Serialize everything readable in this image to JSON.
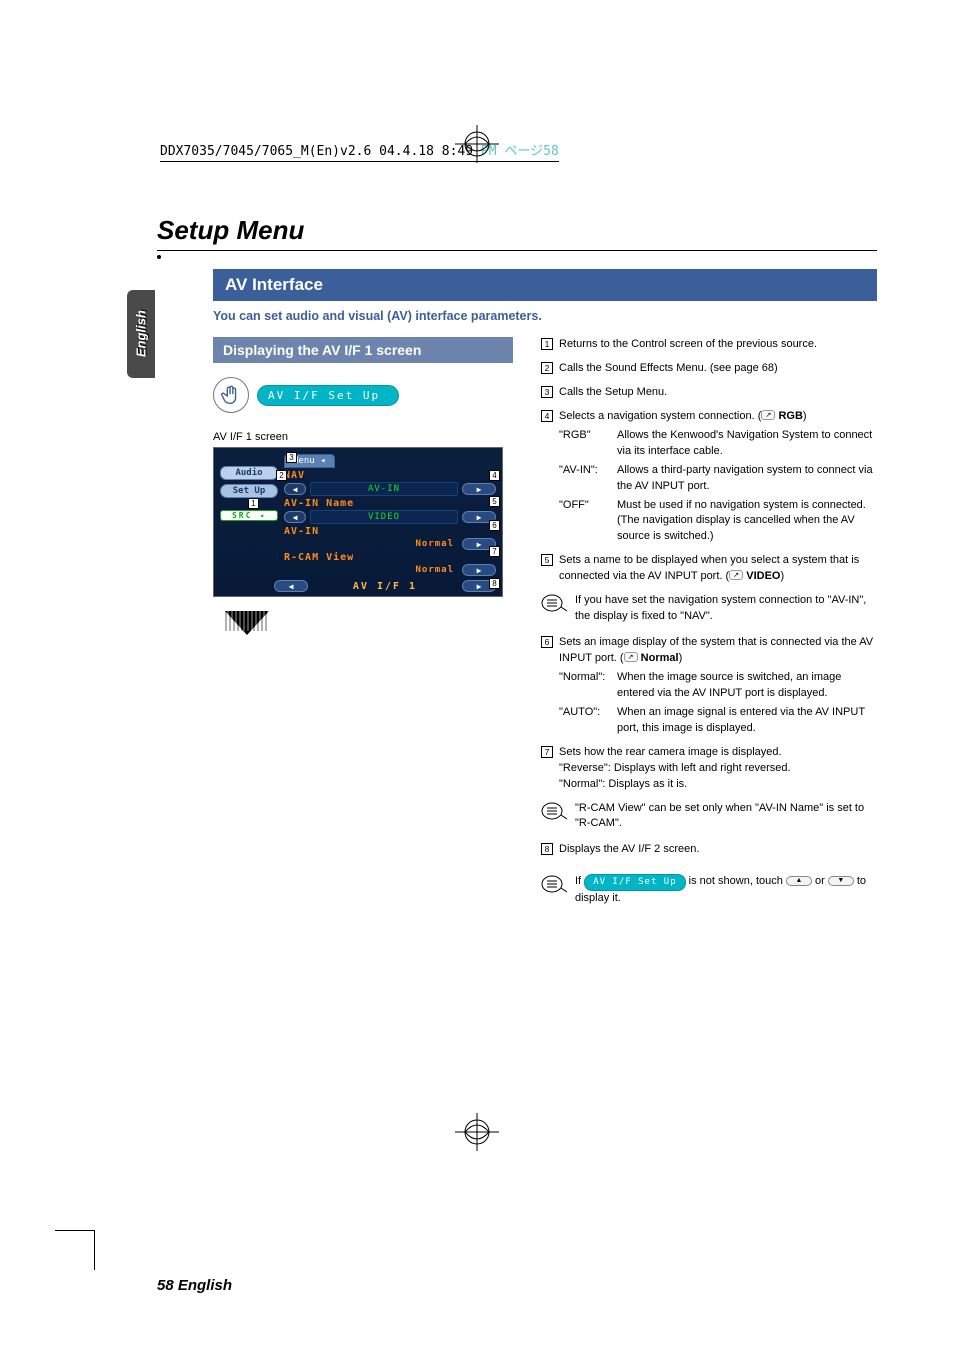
{
  "top_note": {
    "prefix": "DDX7035/7045/7065_M(En)v2.6  04.4.18  8:49",
    "sep": " P",
    "suffix": "M  ページ58"
  },
  "main_title": "Setup Menu",
  "language_tab": "English",
  "section": {
    "title": "AV Interface",
    "subtitle": "You can set audio and visual (AV) interface parameters."
  },
  "left": {
    "subheading": "Displaying the AV I/F 1 screen",
    "pill_label": "AV I/F Set Up",
    "screen_label": "AV I/F 1 screen",
    "ss": {
      "menu": "Menu",
      "audio": "Audio",
      "setup": "Set Up",
      "src": "SRC",
      "nav": "NAV",
      "nav_val": "AV-IN",
      "avin_name": "AV-IN Name",
      "avin_name_val": "VIDEO",
      "avin": "AV-IN",
      "avin_val": "Normal",
      "rcam": "R-CAM View",
      "rcam_val": "Normal",
      "footer": "AV  I/F  1"
    },
    "callouts": {
      "c1": "1",
      "c2": "2",
      "c3": "3",
      "c4": "4",
      "c5": "5",
      "c6": "6",
      "c7": "7",
      "c8": "8"
    }
  },
  "right": {
    "items": [
      {
        "n": "1",
        "text": "Returns to the Control screen of the previous source."
      },
      {
        "n": "2",
        "text": "Calls the Sound Effects Menu. (see page 68)"
      },
      {
        "n": "3",
        "text": "Calls the Setup Menu."
      },
      {
        "n": "4",
        "text": "Selects a navigation system connection. (",
        "iconText": "RGB",
        "textEnd": ")",
        "opts": [
          {
            "k": "\"RGB\"",
            "v": "Allows the Kenwood's Navigation System to connect via its interface cable."
          },
          {
            "k": "\"AV-IN\":",
            "v": "Allows a third-party navigation system to connect via the AV INPUT port."
          },
          {
            "k": "\"OFF\"",
            "v": "Must be used if no navigation system is connected. (The navigation display is cancelled when the AV source is switched.)"
          }
        ]
      },
      {
        "n": "5",
        "text": "Sets a name to be displayed when you select a system that is connected via the AV INPUT port. (",
        "iconText": "VIDEO",
        "textEnd": ")",
        "note": "If you have set the navigation system connection to \"AV-IN\", the display is fixed to \"NAV\"."
      },
      {
        "n": "6",
        "text": "Sets an image display of the system that is connected via the AV INPUT port. (",
        "iconText": "Normal",
        "textEnd": ")",
        "opts": [
          {
            "k": "\"Normal\":",
            "v": "When the image source is switched, an image entered via the AV INPUT port is displayed."
          },
          {
            "k": "\"AUTO\":",
            "v": "When an image signal is entered via the AV INPUT port, this image is displayed."
          }
        ]
      },
      {
        "n": "7",
        "text": "Sets how the rear camera image is displayed.",
        "lines": [
          "\"Reverse\": Displays with left and right reversed.",
          "\"Normal\":  Displays as it is."
        ],
        "note": "\"R-CAM View\" can be set only when \"AV-IN Name\" is set to \"R-CAM\"."
      },
      {
        "n": "8",
        "text": "Displays the AV I/F 2 screen."
      }
    ],
    "footnote": {
      "pre": "If ",
      "btn": "AV I/F Set Up",
      "mid": " is not shown, touch ",
      "or": " or ",
      "end": " to display it."
    }
  },
  "footer": "58 English"
}
